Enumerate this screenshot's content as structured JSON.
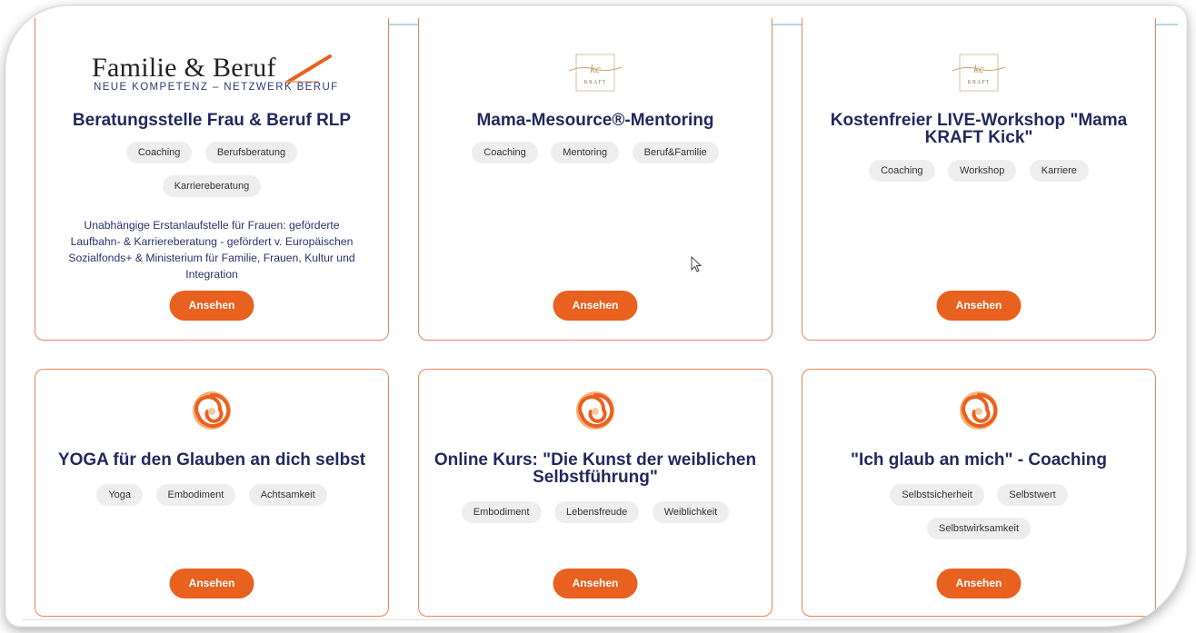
{
  "colors": {
    "accent": "#e8611f",
    "title": "#22295e",
    "border": "#e8845a",
    "tag_bg": "#eeeeee"
  },
  "cards": [
    {
      "logo_title": "Familie & Beruf",
      "logo_subtitle": "NEUE KOMPETENZ – NETZWERK BERUF",
      "title": "Beratungsstelle Frau & Beruf RLP",
      "tags": [
        "Coaching",
        "Berufsberatung",
        "Karriereberatung"
      ],
      "description": "Unabhängige Erstanlaufstelle für Frauen: geförderte Laufbahn- & Karriereberatung - gefördert v. Europäischen Sozialfonds+ & Ministerium für Familie, Frauen, Kultur und Integration",
      "button": "Ansehen"
    },
    {
      "logo_text": "KRAFT",
      "title": "Mama-Mesource®-Mentoring",
      "tags": [
        "Coaching",
        "Mentoring",
        "Beruf&Familie"
      ],
      "button": "Ansehen"
    },
    {
      "logo_text": "KRAFT",
      "title": "Kostenfreier LIVE-Workshop \"Mama KRAFT Kick\"",
      "tags": [
        "Coaching",
        "Workshop",
        "Karriere"
      ],
      "button": "Ansehen"
    },
    {
      "logo_icon": "spiral-logo-icon",
      "title": "YOGA für den Glauben an dich selbst",
      "tags": [
        "Yoga",
        "Embodiment",
        "Achtsamkeit"
      ],
      "button": "Ansehen"
    },
    {
      "logo_icon": "spiral-logo-icon",
      "title": "Online Kurs: \"Die Kunst der weiblichen Selbstführung\"",
      "tags": [
        "Embodiment",
        "Lebensfreude",
        "Weiblichkeit"
      ],
      "button": "Ansehen"
    },
    {
      "logo_icon": "spiral-logo-icon",
      "title": "\"Ich glaub an mich\" - Coaching",
      "tags": [
        "Selbstsicherheit",
        "Selbstwert",
        "Selbstwirksamkeit"
      ],
      "button": "Ansehen"
    }
  ]
}
